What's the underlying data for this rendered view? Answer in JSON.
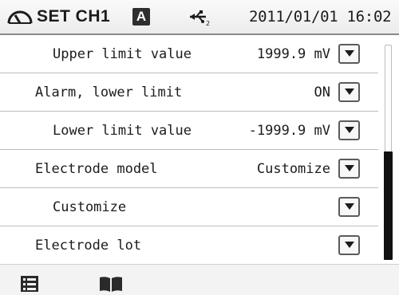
{
  "status": {
    "title": "SET CH1",
    "mode_badge": "A",
    "datetime": "2011/01/01 16:02",
    "icons": [
      "gauge-icon",
      "usb-icon"
    ]
  },
  "settings": [
    {
      "label": "Upper limit value",
      "value": "1999.9 mV",
      "indent": true
    },
    {
      "label": "Alarm, lower limit",
      "value": "ON",
      "indent": false
    },
    {
      "label": "Lower limit value",
      "value": "-1999.9 mV",
      "indent": true
    },
    {
      "label": "Electrode model",
      "value": "Customize",
      "indent": false
    },
    {
      "label": "Customize",
      "value": "",
      "indent": true
    },
    {
      "label": "Electrode lot",
      "value": "",
      "indent": false
    }
  ],
  "scroll_position": 0.75,
  "toolbar": {
    "icons": [
      "list-menu-icon",
      "book-icon"
    ]
  },
  "colors": {
    "text": "#1c1c1c",
    "thumb": "#111111",
    "divider": "#bdbdbd"
  }
}
